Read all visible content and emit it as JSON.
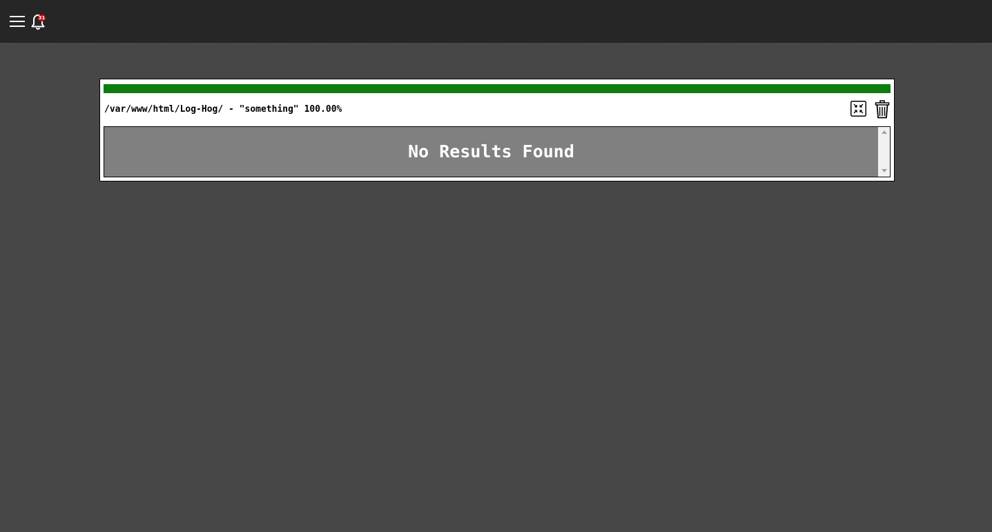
{
  "header": {
    "menu_icon": "hamburger-menu-icon",
    "notifications_icon": "bell-icon",
    "notification_count": "31"
  },
  "search_panel": {
    "progress_percent": 100,
    "progress_color": "#0d7d0d",
    "info_text": "/var/www/html/Log-Hog/ - \"something\" 100.00%",
    "minimize_icon": "minimize-arrows-icon",
    "delete_icon": "trash-icon",
    "results_message": "No Results Found"
  },
  "colors": {
    "background": "#474747",
    "topbar": "#262626",
    "results_background": "#808080",
    "badge": "#d10000"
  }
}
